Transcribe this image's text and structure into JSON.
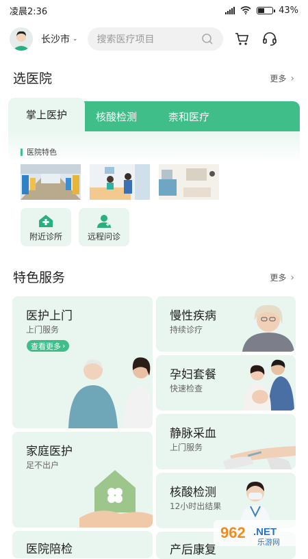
{
  "status": {
    "time": "凌晨2:36",
    "battery": "43",
    "battery_level": 0.43
  },
  "header": {
    "city": "长沙市",
    "search_placeholder": "搜索医疗项目"
  },
  "hospitals": {
    "title": "选医院",
    "more": "更多",
    "tabs": [
      "掌上医护",
      "核酸检测",
      "柰和医疗"
    ],
    "features_label": "医院特色",
    "quick": [
      {
        "label": "附近诊所"
      },
      {
        "label": "远程问诊"
      }
    ]
  },
  "services": {
    "title": "特色服务",
    "more": "更多",
    "cards": [
      {
        "title": "医护上门",
        "sub": "上门服务",
        "button": "查看更多"
      },
      {
        "title": "慢性疾病",
        "sub": "持续诊疗"
      },
      {
        "title": "孕妇套餐",
        "sub": "快速检查"
      },
      {
        "title": "静脉采血",
        "sub": "上门服务"
      },
      {
        "title": "家庭医护",
        "sub": "足不出户"
      },
      {
        "title": "核酸检测",
        "sub": "12小时出结果"
      },
      {
        "title": "医院陪检",
        "sub": ""
      },
      {
        "title": "产后康复",
        "sub": ""
      }
    ]
  },
  "watermark": {
    "brand": "962.NET",
    "sub": "乐游网"
  },
  "colors": {
    "accent": "#3fbe8a",
    "card_bg": "#e9f5ef"
  }
}
